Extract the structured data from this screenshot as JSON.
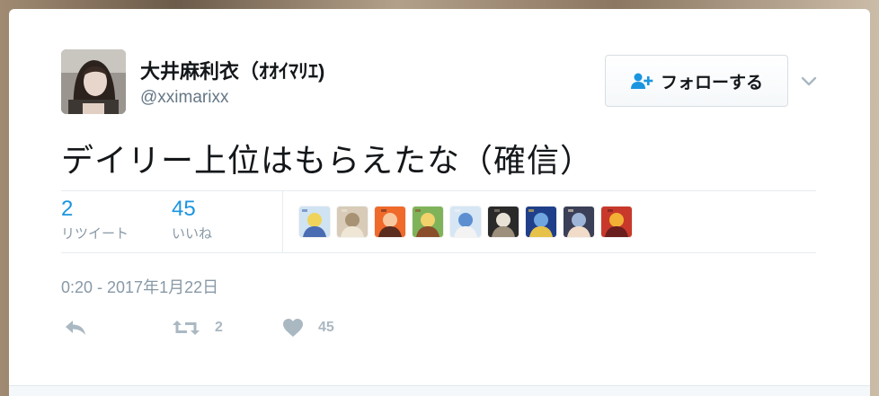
{
  "author": {
    "display_name": "大井麻利衣（ｵｵｲﾏﾘｴ)",
    "handle": "@xximarixx",
    "avatar_icon": "profile-photo"
  },
  "follow_button": {
    "label": "フォローする",
    "icon": "follow-person-icon"
  },
  "menu": {
    "icon": "chevron-down-icon"
  },
  "tweet": {
    "text": "デイリー上位はもらえたな（確信）",
    "timestamp": "0:20 - 2017年1月22日"
  },
  "stats": {
    "retweets": {
      "count": "2",
      "label": "リツイート"
    },
    "likes": {
      "count": "45",
      "label": "いいね"
    }
  },
  "liker_avatars": [
    {
      "name": "liker-avatar-1",
      "colors": [
        "#cfe3f2",
        "#f0d35a",
        "#4a6cb3"
      ]
    },
    {
      "name": "liker-avatar-2",
      "colors": [
        "#d8cbb8",
        "#a89274",
        "#efe6d6"
      ]
    },
    {
      "name": "liker-avatar-3",
      "colors": [
        "#f06a2b",
        "#f8c9a0",
        "#5b2d1f"
      ]
    },
    {
      "name": "liker-avatar-4",
      "colors": [
        "#7fb35a",
        "#f2d26b",
        "#8a4e2b"
      ]
    },
    {
      "name": "liker-avatar-5",
      "colors": [
        "#d6e6f5",
        "#5d8fd0",
        "#f3f3f3"
      ]
    },
    {
      "name": "liker-avatar-6",
      "colors": [
        "#2a2a2a",
        "#e8e2d6",
        "#9c8f7c"
      ]
    },
    {
      "name": "liker-avatar-7",
      "colors": [
        "#1f3f8a",
        "#6fa6e0",
        "#e6c24a"
      ]
    },
    {
      "name": "liker-avatar-8",
      "colors": [
        "#3b3f57",
        "#9fb5d8",
        "#f0dcc8"
      ]
    },
    {
      "name": "liker-avatar-9",
      "colors": [
        "#c8392b",
        "#f2b134",
        "#6a1e1e"
      ]
    }
  ],
  "actions": {
    "reply": {
      "icon": "reply-icon"
    },
    "retweet": {
      "icon": "retweet-icon",
      "count": "2"
    },
    "like": {
      "icon": "heart-icon",
      "count": "45"
    }
  },
  "colors": {
    "accent": "#1b95e0",
    "muted": "#8899a6",
    "icon_gray": "#aab8c2"
  }
}
